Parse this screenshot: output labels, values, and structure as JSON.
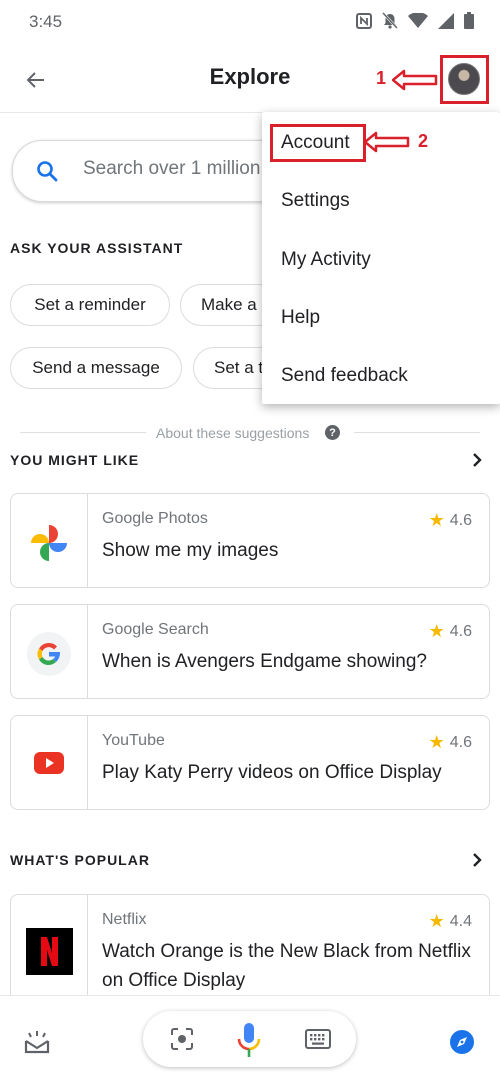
{
  "status": {
    "time": "3:45"
  },
  "header": {
    "title": "Explore"
  },
  "search": {
    "placeholder": "Search over 1 million"
  },
  "assistant": {
    "heading": "ASK YOUR ASSISTANT",
    "chips": [
      "Set a reminder",
      "Make a",
      "Send a message",
      "Set a t"
    ]
  },
  "suggestions_note": "About these suggestions",
  "might_like": {
    "heading": "YOU MIGHT LIKE",
    "cards": [
      {
        "app": "Google Photos",
        "text": "Show me my images",
        "rating": "4.6",
        "icon": "google-photos-icon"
      },
      {
        "app": "Google Search",
        "text": "When is Avengers Endgame showing?",
        "rating": "4.6",
        "icon": "google-g-icon"
      },
      {
        "app": "YouTube",
        "text": "Play Katy Perry videos on Office Display",
        "rating": "4.6",
        "icon": "youtube-icon"
      }
    ]
  },
  "popular": {
    "heading": "WHAT'S POPULAR",
    "cards": [
      {
        "app": "Netflix",
        "text": "Watch Orange is the New Black from Netflix on Office Display",
        "rating": "4.4",
        "icon": "netflix-icon"
      }
    ]
  },
  "menu": {
    "items": [
      "Account",
      "Settings",
      "My Activity",
      "Help",
      "Send feedback"
    ]
  },
  "annotations": {
    "one": "1",
    "two": "2"
  },
  "colors": {
    "annotation": "#d9202b",
    "accent": "#1a73e8",
    "star": "#f6b900"
  }
}
